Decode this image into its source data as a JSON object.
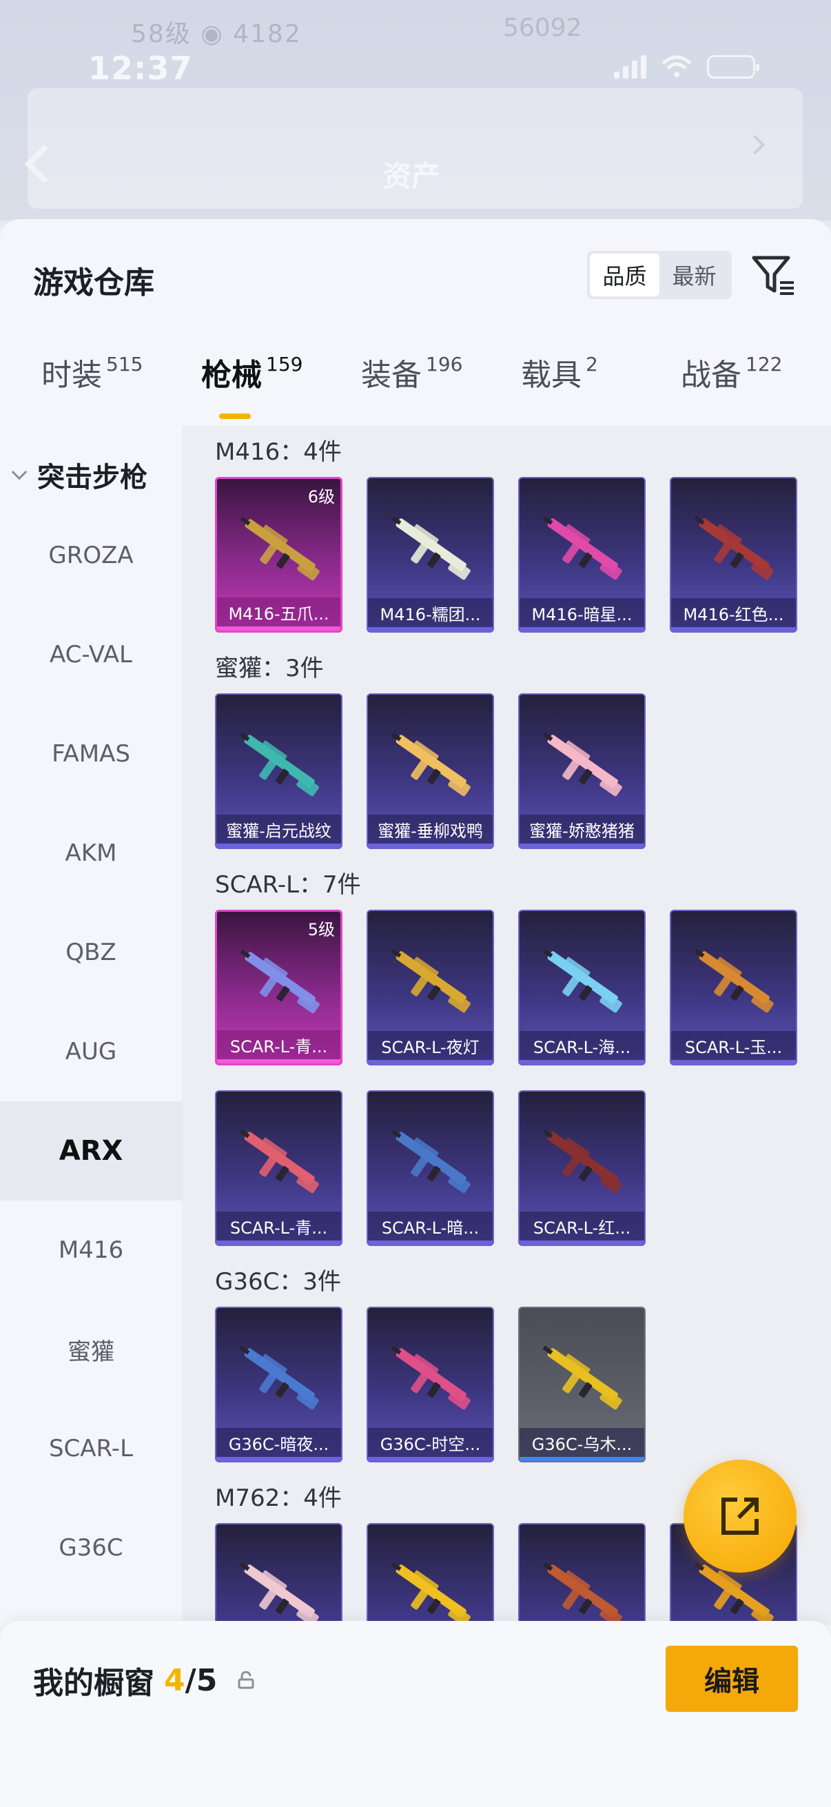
{
  "status_bar": {
    "time": "12:37"
  },
  "backdrop": {
    "line1": "58级 ◉ 4182",
    "line2": "56092",
    "title": "资产"
  },
  "header": {
    "title": "游戏仓库",
    "sort_options": [
      "品质",
      "最新"
    ],
    "sort_selected": "品质",
    "filter_icon": "filter-icon"
  },
  "tabs": [
    {
      "label": "时装",
      "count": "515"
    },
    {
      "label": "枪械",
      "count": "159"
    },
    {
      "label": "装备",
      "count": "196"
    },
    {
      "label": "载具",
      "count": "2"
    },
    {
      "label": "战备",
      "count": "122"
    }
  ],
  "active_tab": "枪械",
  "sidebar": {
    "header": "突击步枪",
    "items": [
      "GROZA",
      "AC-VAL",
      "FAMAS",
      "AKM",
      "QBZ",
      "AUG",
      "ARX",
      "M416",
      "蜜獾",
      "SCAR-L",
      "G36C"
    ],
    "selected": "ARX"
  },
  "sections": [
    {
      "title": "M416：4件",
      "items": [
        {
          "name": "M416-五爪...",
          "level": "6级",
          "rarity": "pink",
          "color": "#c8a040"
        },
        {
          "name": "M416-糯团...",
          "level": "",
          "rarity": "purple",
          "color": "#e8ecd8"
        },
        {
          "name": "M416-暗星...",
          "level": "",
          "rarity": "purple",
          "color": "#e04aa8"
        },
        {
          "name": "M416-红色...",
          "level": "",
          "rarity": "purple",
          "color": "#a83838"
        }
      ]
    },
    {
      "title": "蜜獾：3件",
      "items": [
        {
          "name": "蜜獾-启元战纹",
          "level": "",
          "rarity": "purple",
          "color": "#3fb8b0"
        },
        {
          "name": "蜜獾-垂柳戏鸭",
          "level": "",
          "rarity": "purple",
          "color": "#f0c060"
        },
        {
          "name": "蜜獾-娇憨猪猪",
          "level": "",
          "rarity": "purple",
          "color": "#f6b8c8"
        }
      ]
    },
    {
      "title": "SCAR-L：7件",
      "items": [
        {
          "name": "SCAR-L-青...",
          "level": "5级",
          "rarity": "pink",
          "color": "#8090e8"
        },
        {
          "name": "SCAR-L-夜灯",
          "level": "",
          "rarity": "purple",
          "color": "#d8a830"
        },
        {
          "name": "SCAR-L-海...",
          "level": "",
          "rarity": "purple",
          "color": "#7ad0f0"
        },
        {
          "name": "SCAR-L-玉...",
          "level": "",
          "rarity": "purple",
          "color": "#d88a30"
        },
        {
          "name": "SCAR-L-青...",
          "level": "",
          "rarity": "purple",
          "color": "#e06070"
        },
        {
          "name": "SCAR-L-暗...",
          "level": "",
          "rarity": "purple",
          "color": "#4a78c8"
        },
        {
          "name": "SCAR-L-红...",
          "level": "",
          "rarity": "purple",
          "color": "#8a3030"
        }
      ]
    },
    {
      "title": "G36C：3件",
      "items": [
        {
          "name": "G36C-暗夜...",
          "level": "",
          "rarity": "purple",
          "color": "#4a7ad0"
        },
        {
          "name": "G36C-时空...",
          "level": "",
          "rarity": "purple",
          "color": "#e05088"
        },
        {
          "name": "G36C-乌木...",
          "level": "",
          "rarity": "gray",
          "color": "#e8c020"
        }
      ]
    },
    {
      "title": "M762：4件",
      "items": [
        {
          "name": "",
          "level": "",
          "rarity": "purple",
          "color": "#f0c8d0"
        },
        {
          "name": "",
          "level": "",
          "rarity": "purple",
          "color": "#f0c020"
        },
        {
          "name": "",
          "level": "",
          "rarity": "purple",
          "color": "#c05a30"
        },
        {
          "name": "",
          "level": "",
          "rarity": "purple",
          "color": "#e8a020"
        }
      ]
    }
  ],
  "fab_icon": "share-icon",
  "showcase": {
    "label": "我的橱窗",
    "current": "4",
    "total": "/5",
    "lock_icon": "lock-icon"
  },
  "edit_button": "编辑"
}
